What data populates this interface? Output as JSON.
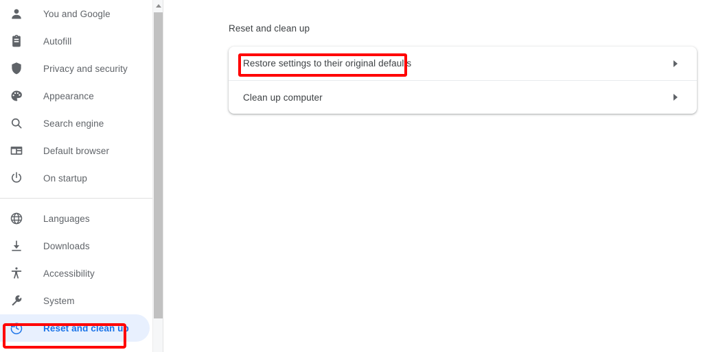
{
  "colors": {
    "accent_blue": "#1a73e8",
    "selected_pill_bg": "#e8f0fe",
    "text_gray": "#5f6368",
    "text_dark": "#3c4043",
    "annotation_red": "#ff0000",
    "card_bg": "#ffffff",
    "scrollbar_thumb": "#c1c1c1"
  },
  "sidebar": {
    "group_one": [
      {
        "label": "You and Google",
        "icon": "person-icon",
        "selected": false
      },
      {
        "label": "Autofill",
        "icon": "clipboard-icon",
        "selected": false
      },
      {
        "label": "Privacy and security",
        "icon": "shield-icon",
        "selected": false
      },
      {
        "label": "Appearance",
        "icon": "palette-icon",
        "selected": false
      },
      {
        "label": "Search engine",
        "icon": "search-icon",
        "selected": false
      },
      {
        "label": "Default browser",
        "icon": "browser-window-icon",
        "selected": false
      },
      {
        "label": "On startup",
        "icon": "power-icon",
        "selected": false
      }
    ],
    "group_two": [
      {
        "label": "Languages",
        "icon": "globe-icon",
        "selected": false
      },
      {
        "label": "Downloads",
        "icon": "download-icon",
        "selected": false
      },
      {
        "label": "Accessibility",
        "icon": "accessibility-icon",
        "selected": false
      },
      {
        "label": "System",
        "icon": "wrench-icon",
        "selected": false
      },
      {
        "label": "Reset and clean up",
        "icon": "history-restore-icon",
        "selected": true
      }
    ]
  },
  "scrollbar": {
    "up_arrow_icon": "triangle-up-icon",
    "thumb_label": "vertical-scroll-thumb"
  },
  "main": {
    "page_title": "Reset and clean up",
    "rows": [
      {
        "label": "Restore settings to their original defaults",
        "chevron_icon": "chevron-right-icon"
      },
      {
        "label": "Clean up computer",
        "chevron_icon": "chevron-right-icon"
      }
    ]
  },
  "annotations": [
    {
      "name": "annotation-restore-settings",
      "target": "Restore settings to their original defaults"
    },
    {
      "name": "annotation-reset-and-clean-up",
      "target": "Reset and clean up"
    }
  ]
}
